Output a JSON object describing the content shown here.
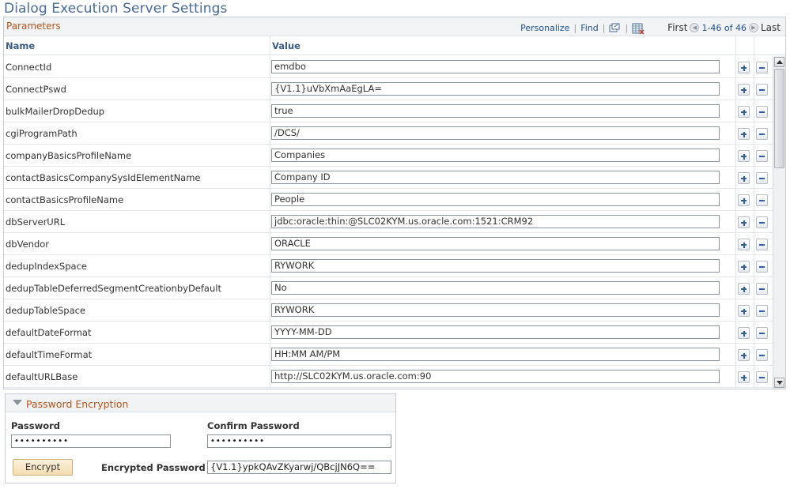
{
  "page": {
    "title": "Dialog Execution Server Settings"
  },
  "grid": {
    "label": "Parameters",
    "nav": {
      "personalize": "Personalize",
      "find": "Find",
      "first": "First",
      "range": "1-46 of 46",
      "last": "Last"
    },
    "columns": {
      "name": "Name",
      "value": "Value"
    },
    "rows": [
      {
        "name": "ConnectId",
        "value": "emdbo"
      },
      {
        "name": "ConnectPswd",
        "value": "{V1.1}uVbXmAaEgLA="
      },
      {
        "name": "bulkMailerDropDedup",
        "value": "true"
      },
      {
        "name": "cgiProgramPath",
        "value": "/DCS/"
      },
      {
        "name": "companyBasicsProfileName",
        "value": "Companies"
      },
      {
        "name": "contactBasicsCompanySysIdElementName",
        "value": "Company ID"
      },
      {
        "name": "contactBasicsProfileName",
        "value": "People"
      },
      {
        "name": "dbServerURL",
        "value": "jdbc:oracle:thin:@SLC02KYM.us.oracle.com:1521:CRM92"
      },
      {
        "name": "dbVendor",
        "value": "ORACLE"
      },
      {
        "name": "dedupIndexSpace",
        "value": "RYWORK"
      },
      {
        "name": "dedupTableDeferredSegmentCreationbyDefault",
        "value": "No"
      },
      {
        "name": "dedupTableSpace",
        "value": "RYWORK"
      },
      {
        "name": "defaultDateFormat",
        "value": "YYYY-MM-DD"
      },
      {
        "name": "defaultTimeFormat",
        "value": "HH:MM AM/PM"
      },
      {
        "name": "defaultURLBase",
        "value": "http://SLC02KYM.us.oracle.com:90"
      }
    ],
    "icons": {
      "add": "plus-icon",
      "remove": "minus-icon",
      "zoom": "view-all-icon",
      "download": "download-excel-icon"
    }
  },
  "password_encryption": {
    "title": "Password Encryption",
    "password_label": "Password",
    "password_value": "••••••••••",
    "confirm_label": "Confirm Password",
    "confirm_value": "••••••••••",
    "encrypt_button": "Encrypt",
    "encrypted_label": "Encrypted Password",
    "encrypted_value": "{V1.1}ypkQAvZKyarwj/QBcjJN6Q=="
  },
  "colors": {
    "title": "#4a6b92",
    "section_label": "#b3541e",
    "link": "#1f4f8c",
    "header_bg": "#f1f3f5"
  }
}
